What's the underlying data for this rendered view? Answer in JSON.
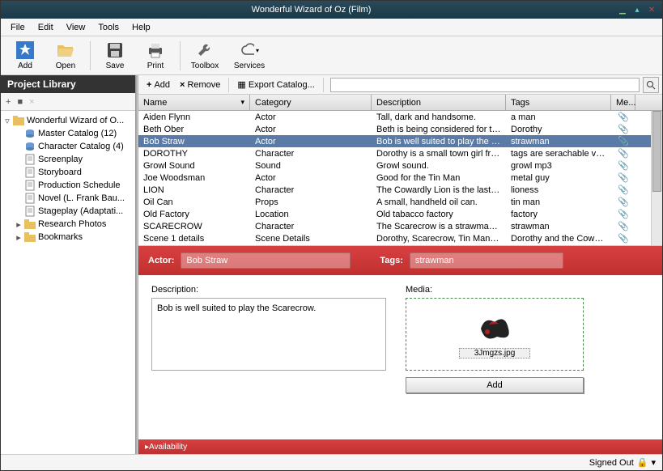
{
  "window": {
    "title": "Wonderful Wizard of Oz (Film)"
  },
  "menu": [
    "File",
    "Edit",
    "View",
    "Tools",
    "Help"
  ],
  "toolbar": [
    {
      "label": "Add",
      "icon": "star"
    },
    {
      "label": "Open",
      "icon": "folder"
    },
    {
      "label": "Save",
      "icon": "disk"
    },
    {
      "label": "Print",
      "icon": "print"
    },
    {
      "label": "Toolbox",
      "icon": "wrench"
    },
    {
      "label": "Services",
      "icon": "cloud"
    }
  ],
  "sidebar": {
    "title": "Project Library",
    "root": "Wonderful Wizard of O...",
    "items": [
      {
        "label": "Master Catalog (12)",
        "icon": "db"
      },
      {
        "label": "Character Catalog (4)",
        "icon": "db"
      },
      {
        "label": "Screenplay",
        "icon": "doc"
      },
      {
        "label": "Storyboard",
        "icon": "doc"
      },
      {
        "label": "Production Schedule",
        "icon": "doc"
      },
      {
        "label": "Novel (L. Frank Bau...",
        "icon": "doc"
      },
      {
        "label": "Stageplay (Adaptati...",
        "icon": "doc"
      },
      {
        "label": "Research Photos",
        "icon": "folder",
        "expand": true
      },
      {
        "label": "Bookmarks",
        "icon": "folder",
        "expand": true
      }
    ]
  },
  "mainbar": {
    "add": "Add",
    "remove": "Remove",
    "export": "Export Catalog..."
  },
  "columns": [
    "Name",
    "Category",
    "Description",
    "Tags",
    "Me..."
  ],
  "rows": [
    {
      "name": "Aiden Flynn",
      "cat": "Actor",
      "desc": "Tall, dark and handsome.",
      "tags": "a man"
    },
    {
      "name": "Beth Ober",
      "cat": "Actor",
      "desc": "Beth is being considered for th...",
      "tags": "Dorothy"
    },
    {
      "name": "Bob Straw",
      "cat": "Actor",
      "desc": "Bob is well suited to play the Sc...",
      "tags": "strawman",
      "sel": true
    },
    {
      "name": "DOROTHY",
      "cat": "Character",
      "desc": "Dorothy is a small town girl fro...",
      "tags": "tags are serachable via t..."
    },
    {
      "name": "Growl Sound",
      "cat": "Sound",
      "desc": "Growl sound.",
      "tags": "growl mp3"
    },
    {
      "name": "Joe Woodsman",
      "cat": "Actor",
      "desc": "Good for the Tin Man",
      "tags": "metal guy"
    },
    {
      "name": "LION",
      "cat": "Character",
      "desc": "The Cowardly Lion is the last of ...",
      "tags": "lioness"
    },
    {
      "name": "Oil Can",
      "cat": "Props",
      "desc": "A small, handheld oil can.",
      "tags": "tin man"
    },
    {
      "name": "Old Factory",
      "cat": "Location",
      "desc": "Old tabacco factory",
      "tags": "factory"
    },
    {
      "name": "SCARECROW",
      "cat": "Character",
      "desc": "The Scarecrow is a strawman in ...",
      "tags": "strawman"
    },
    {
      "name": "Scene 1 details",
      "cat": "Scene Details",
      "desc": "Dorothy, Scarecrow, Tin Man a...",
      "tags": "Dorothy and the Cowar..."
    }
  ],
  "detail": {
    "actor_lbl": "Actor:",
    "actor": "Bob Straw",
    "tags_lbl": "Tags:",
    "tags": "strawman",
    "desc_lbl": "Description:",
    "desc": "Bob is well suited to play the Scarecrow.",
    "media_lbl": "Media:",
    "media_file": "3Jmgzs.jpg",
    "add": "Add",
    "footer": "Availability"
  },
  "status": {
    "text": "Signed Out"
  }
}
